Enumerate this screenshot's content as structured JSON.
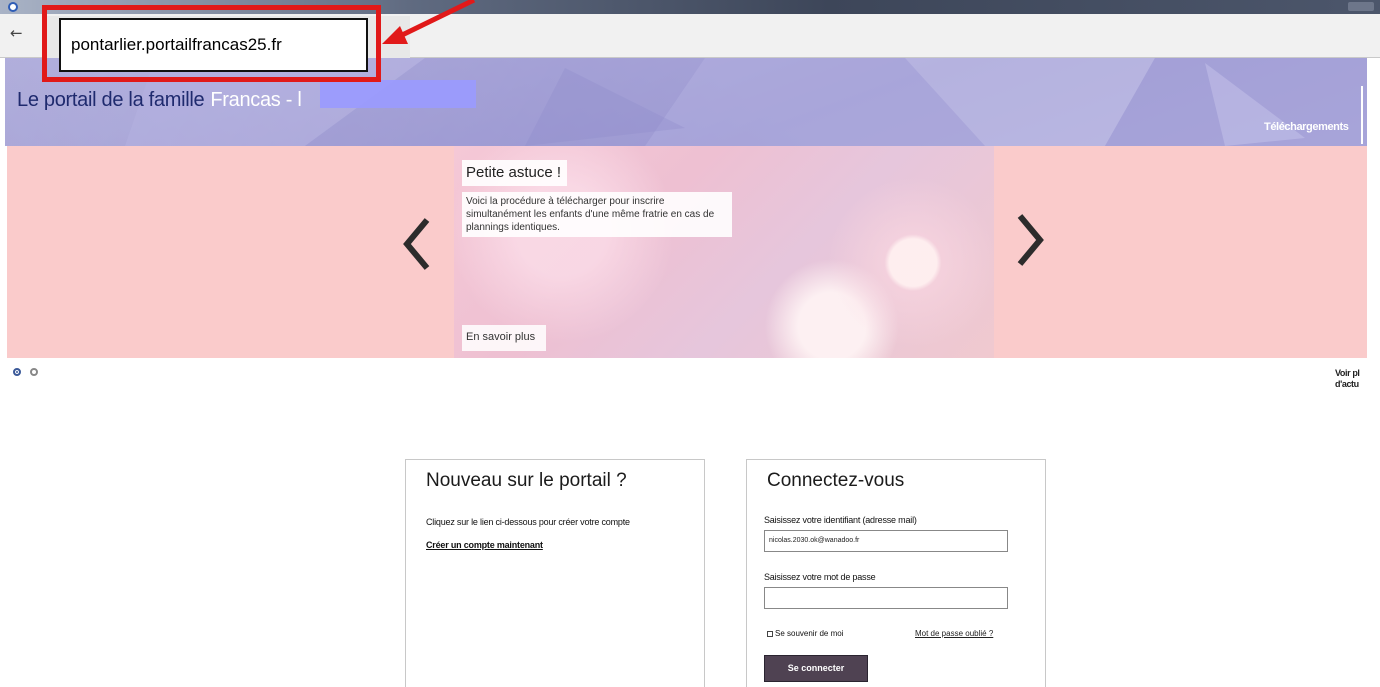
{
  "browser": {
    "url": "pontarlier.portailfrancas25.fr",
    "back_glyph": "←",
    "reload_glyph": "¢"
  },
  "header": {
    "brand_prefix": "Le portail de la famille",
    "brand_accent": "Francas - l",
    "downloads_link": "Téléchargements",
    "background_color": "#a8a5d8",
    "brand_color": "#1f2a6e"
  },
  "carousel": {
    "slide_title": "Petite astuce !",
    "slide_text": "Voici la procédure à télécharger pour inscrire simultanément les enfants d'une même fratrie en cas de plannings identiques.",
    "slide_more": "En savoir plus",
    "right_cut_text_1": "Voir pl",
    "right_cut_text_2": "d'actu",
    "background_color": "#facbcb",
    "prev_icon": "chevron-left-icon",
    "next_icon": "chevron-right-icon"
  },
  "new_panel": {
    "title": "Nouveau sur le portail ?",
    "description": "Cliquez sur le lien ci-dessous pour créer votre compte",
    "create_link": "Créer un compte maintenant"
  },
  "login_panel": {
    "title": "Connectez-vous",
    "identifier_label": "Saisissez votre identifiant (adresse mail)",
    "identifier_value": "nicolas.2030.ok@wanadoo.fr",
    "password_label": "Saisissez votre mot de passe",
    "remember_label": "Se souvenir de moi",
    "forgot_link": "Mot de passe oublié ?",
    "submit": "Se connecter",
    "button_color": "#4f4252"
  },
  "annotation": {
    "callout_color": "#e11919"
  }
}
